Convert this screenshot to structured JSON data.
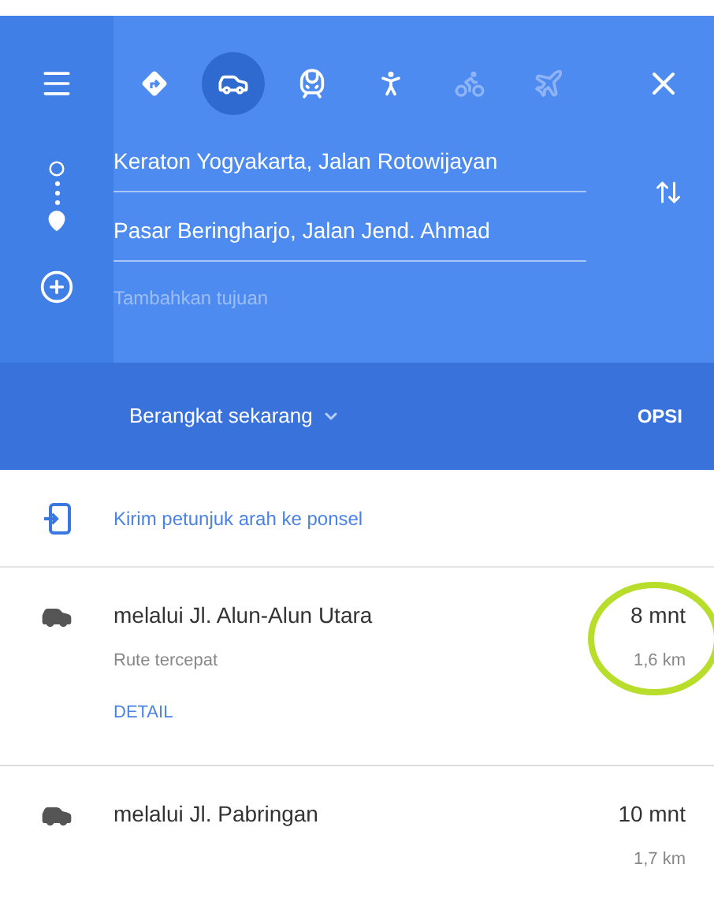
{
  "modes": [
    {
      "kind": "best",
      "selected": false,
      "disabled": false
    },
    {
      "kind": "car",
      "selected": true,
      "disabled": false
    },
    {
      "kind": "transit",
      "selected": false,
      "disabled": false
    },
    {
      "kind": "walk",
      "selected": false,
      "disabled": false
    },
    {
      "kind": "bike",
      "selected": false,
      "disabled": true
    },
    {
      "kind": "flight",
      "selected": false,
      "disabled": true
    }
  ],
  "origin": {
    "value": "Keraton Yogyakarta, Jalan Rotowijayan"
  },
  "destination": {
    "value": "Pasar Beringharjo, Jalan Jend. Ahmad"
  },
  "add_destination": {
    "placeholder": "Tambahkan tujuan"
  },
  "depart": {
    "label": "Berangkat sekarang",
    "options": "OPSI"
  },
  "send_to_phone": "Kirim petunjuk arah ke ponsel",
  "routes": [
    {
      "name": "melalui Jl. Alun-Alun Utara",
      "duration": "8 mnt",
      "note": "Rute tercepat",
      "distance": "1,6 km",
      "details": "DETAIL",
      "highlighted": true
    },
    {
      "name": "melalui Jl. Pabringan",
      "duration": "10 mnt",
      "distance": "1,7 km",
      "highlighted": false
    }
  ]
}
